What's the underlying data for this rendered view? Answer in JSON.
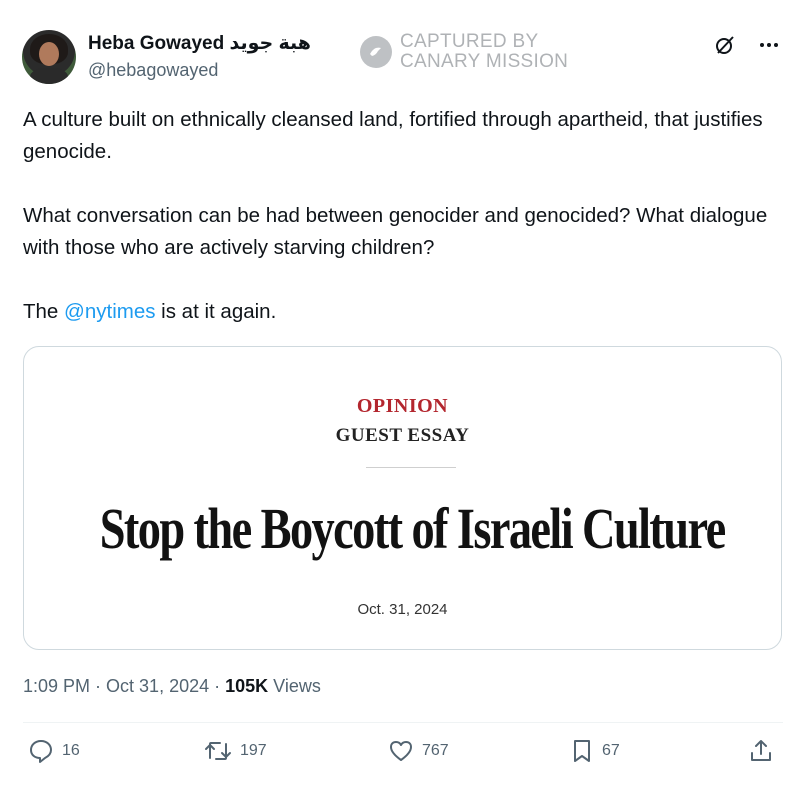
{
  "author": {
    "display_name": "Heba Gowayed هبة جويد",
    "handle": "@hebagowayed"
  },
  "watermark": {
    "line1": "CAPTURED BY",
    "line2": "CANARY MISSION"
  },
  "tweet": {
    "paragraph1": "A culture built on ethnically cleansed land, fortified through apartheid, that justifies genocide.",
    "paragraph2": "What conversation can be had between genocider and genocided? What dialogue with those who are actively starving children?",
    "paragraph3_prefix": "The ",
    "mention": "@nytimes",
    "paragraph3_suffix": " is at it again."
  },
  "card": {
    "section": "OPINION",
    "subsection": "GUEST ESSAY",
    "headline": "Stop the Boycott of Israeli Culture",
    "date": "Oct. 31, 2024"
  },
  "meta": {
    "time": "1:09 PM",
    "separator": " · ",
    "date": "Oct 31, 2024",
    "views_count": "105K",
    "views_label": " Views"
  },
  "actions": {
    "replies": "16",
    "reposts": "197",
    "likes": "767",
    "bookmarks": "67"
  },
  "icons": [
    "grok-icon",
    "more-icon",
    "reply-icon",
    "repost-icon",
    "like-icon",
    "bookmark-icon",
    "share-icon",
    "canary-mission-logo-icon"
  ],
  "colors": {
    "text": "#0f1419",
    "secondary": "#536471",
    "link": "#1d9bf0",
    "opinion_red": "#b3262e",
    "border": "#cfd9de"
  }
}
